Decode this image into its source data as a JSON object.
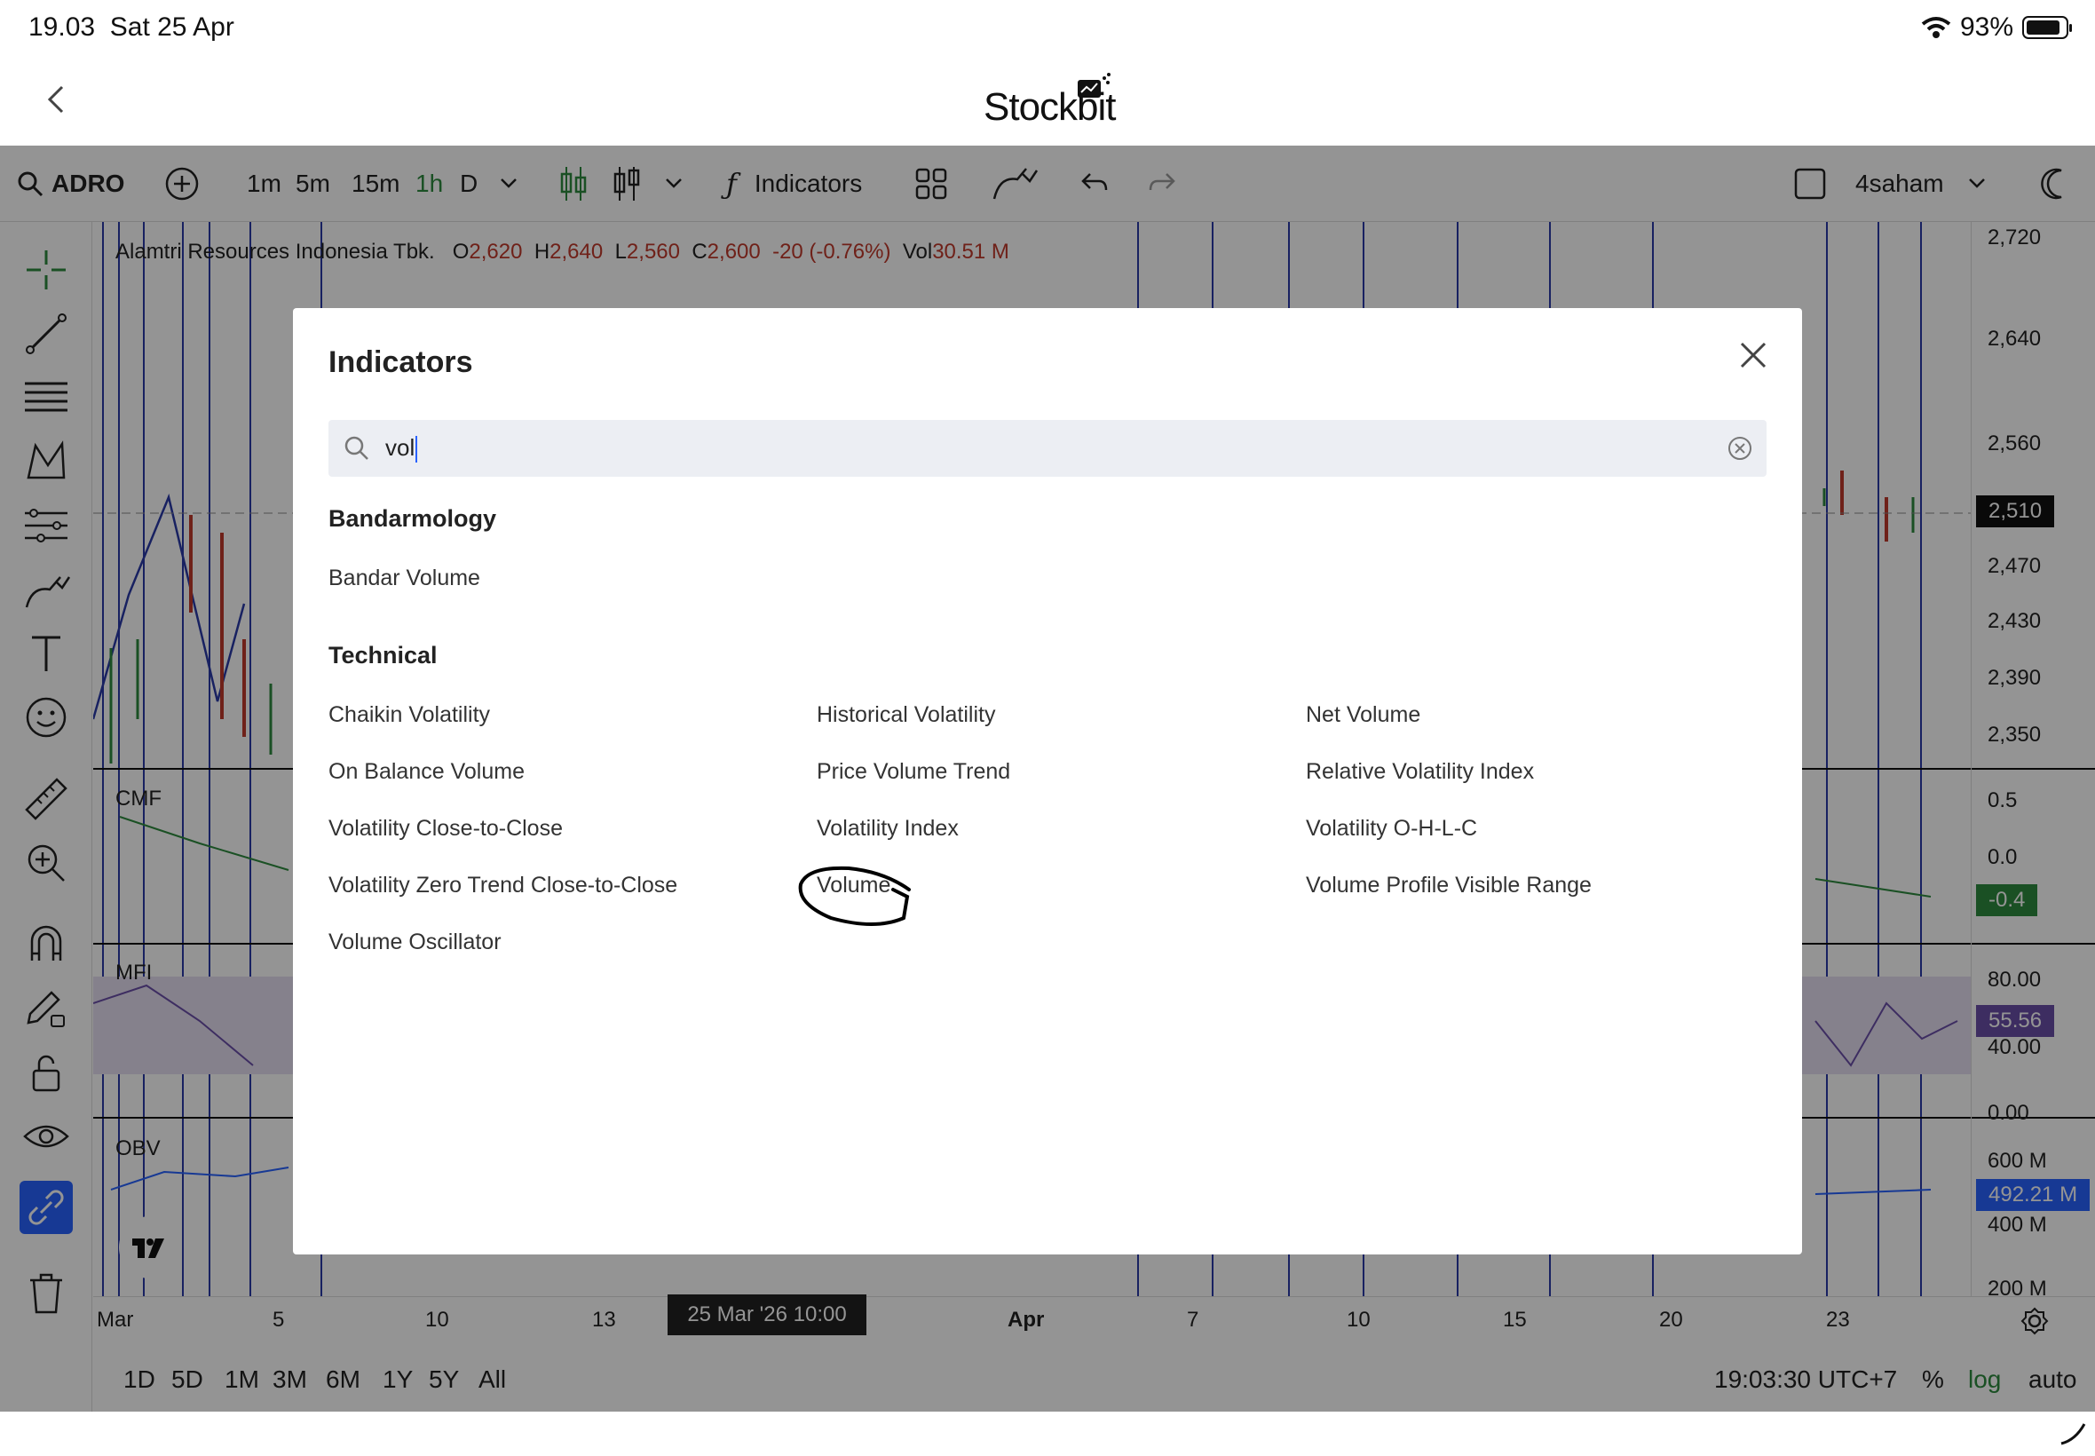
{
  "status": {
    "time": "19.03",
    "date": "Sat 25 Apr",
    "battery": "93%"
  },
  "header": {
    "logo": "Stockbit"
  },
  "toolbar": {
    "symbol": "ADRO",
    "intervals": [
      "1m",
      "5m",
      "15m",
      "1h",
      "D"
    ],
    "active_interval": "1h",
    "indicators_label": "Indicators",
    "layout_name": "4saham"
  },
  "legend": {
    "name": "Alamtri Resources Indonesia Tbk.",
    "o_label": "O",
    "o": "2,620",
    "h_label": "H",
    "h": "2,640",
    "l_label": "L",
    "l": "2,560",
    "c_label": "C",
    "c": "2,600",
    "change": "-20 (-0.76%)",
    "vol_label": "Vol",
    "vol": "30.51 M"
  },
  "price_scale": [
    "2,720",
    "2,640",
    "2,560",
    "2,470",
    "2,430",
    "2,390",
    "2,350",
    "0.5",
    "0.0",
    "80.00",
    "40.00",
    "0.00",
    "600 M",
    "400 M",
    "200 M"
  ],
  "price_badges": {
    "last": "2,510",
    "cmf": "-0.4",
    "mfi": "55.56",
    "obv": "492.21 M"
  },
  "panes": {
    "cmf": "CMF",
    "mfi": "MFI",
    "obv": "OBV"
  },
  "time_axis": [
    "Mar",
    "5",
    "10",
    "13",
    "Apr",
    "7",
    "10",
    "15",
    "20",
    "23"
  ],
  "crosshair_time": "25 Mar '26  10:00",
  "bottom": {
    "ranges": [
      "1D",
      "5D",
      "1M",
      "3M",
      "6M",
      "1Y",
      "5Y",
      "All"
    ],
    "clock": "19:03:30 UTC+7",
    "percent": "%",
    "log": "log",
    "auto": "auto"
  },
  "modal": {
    "title": "Indicators",
    "search_value": "vol",
    "sections": [
      {
        "title": "Bandarmology",
        "items": [
          "Bandar Volume"
        ]
      },
      {
        "title": "Technical",
        "items": [
          "Chaikin Volatility",
          "Historical Volatility",
          "Net Volume",
          "On Balance Volume",
          "Price Volume Trend",
          "Relative Volatility Index",
          "Volatility Close-to-Close",
          "Volatility Index",
          "Volatility O-H-L-C",
          "Volatility Zero Trend Close-to-Close",
          "Volume",
          "Volume Profile Visible Range",
          "Volume Oscillator"
        ]
      }
    ]
  },
  "colors": {
    "accent": "#2962ff",
    "up": "#2e8b3e",
    "down": "#c0392b",
    "vline": "#2a3aa8"
  }
}
